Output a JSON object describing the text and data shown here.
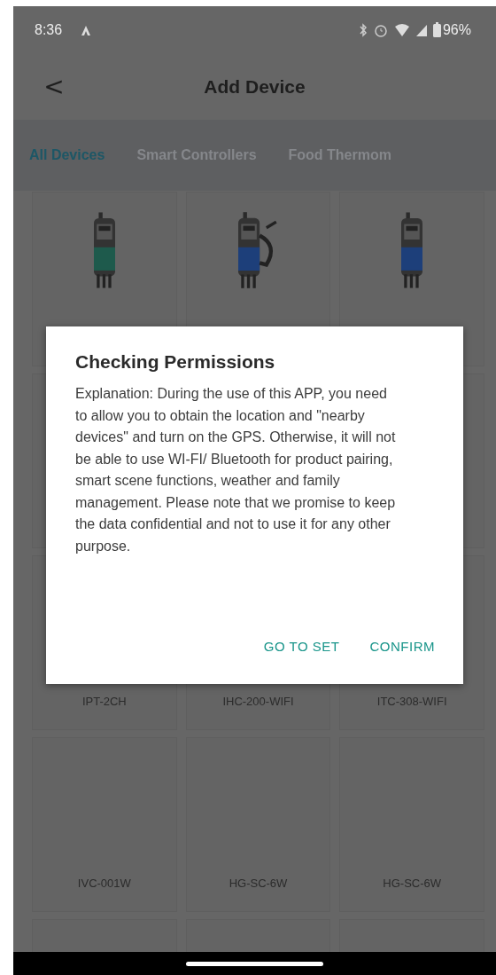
{
  "status_bar": {
    "time": "8:36",
    "battery": "96%"
  },
  "header": {
    "title": "Add Device",
    "back": "<"
  },
  "tabs": [
    {
      "label": "All Devices",
      "selected": true
    },
    {
      "label": "Smart Controllers",
      "selected": false
    },
    {
      "label": "Food Thermom",
      "selected": false
    }
  ],
  "grid_rows": [
    {
      "cards": [
        {
          "kind": "plug",
          "color": "#1e5a4c"
        },
        {
          "kind": "plug-cord",
          "color": "#1d3f7a"
        },
        {
          "kind": "plug",
          "color": "#1d3f7a"
        }
      ]
    },
    {
      "cards": [
        {
          "name": "IPT-2CH"
        },
        {
          "name": "IHC-200-WIFI"
        },
        {
          "name": "ITC-308-WIFI"
        }
      ]
    },
    {
      "cards": [
        {
          "name": "IVC-001W"
        },
        {
          "name": "HG-SC-6W"
        },
        {
          "name": "HG-SC-6W"
        }
      ]
    }
  ],
  "dialog": {
    "title": "Checking Permissions",
    "message": "Explanation: During the use of this APP, you need to allow you to obtain the location and \"nearby devices\" and turn on the GPS. Otherwise, it will not be able to use WI-FI/ Bluetooth for product pairing, smart scene functions, weather and family management. Please note that we promise to keep the data confidential and not to use it for any other purpose.",
    "buttons": [
      "GO TO SET",
      "CONFIRM"
    ]
  }
}
